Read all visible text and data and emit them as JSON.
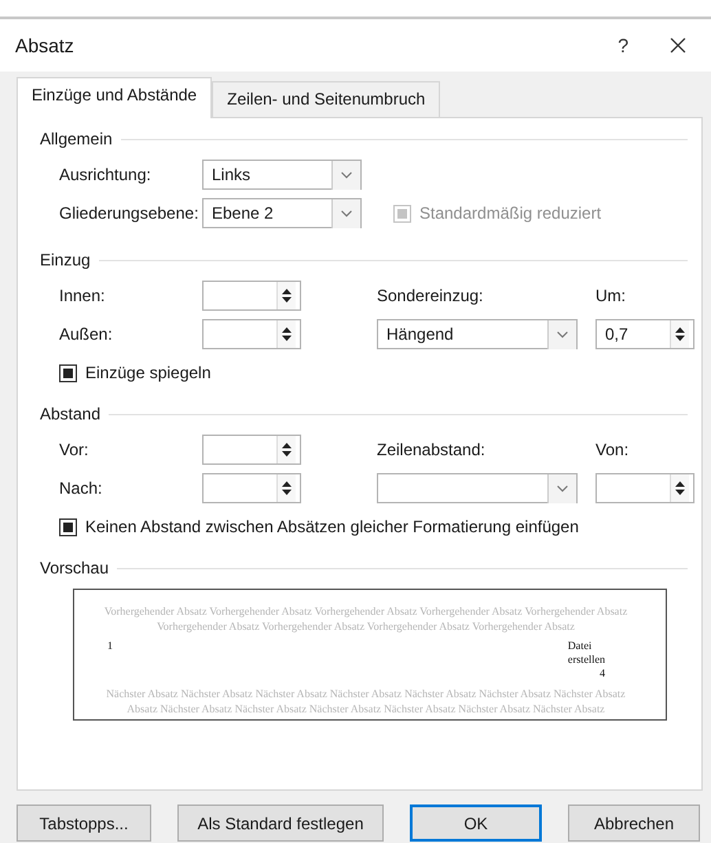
{
  "window": {
    "title": "Absatz",
    "help": "?"
  },
  "tabs": [
    {
      "label": "Einzüge und Abstände",
      "selected": true
    },
    {
      "label": "Zeilen- und Seitenumbruch",
      "selected": false
    }
  ],
  "general": {
    "title": "Allgemein",
    "alignment": {
      "label": "Ausrichtung:",
      "value": "Links"
    },
    "outline_level": {
      "label": "Gliederungsebene:",
      "value": "Ebene 2"
    },
    "collapsed": {
      "label": "Standardmäßig reduziert",
      "checked": true,
      "disabled": true
    }
  },
  "indent": {
    "title": "Einzug",
    "inside": {
      "label": "Innen:"
    },
    "outside": {
      "label": "Außen:"
    },
    "special": {
      "label": "Sondereinzug:",
      "value": "Hängend"
    },
    "by": {
      "label": "Um:",
      "value": "0,7"
    },
    "mirror": {
      "label": "Einzüge spiegeln",
      "checked": true,
      "disabled": false
    }
  },
  "spacing": {
    "title": "Abstand",
    "before": {
      "label": "Vor:"
    },
    "after": {
      "label": "Nach:"
    },
    "line_spacing": {
      "label": "Zeilenabstand:"
    },
    "at": {
      "label": "Von:"
    },
    "no_space": {
      "label": "Keinen Abstand zwischen Absätzen gleicher Formatierung einfügen",
      "checked": true,
      "disabled": false
    }
  },
  "preview": {
    "title": "Vorschau",
    "previous": "Vorhergehender Absatz Vorhergehender Absatz Vorhergehender Absatz Vorhergehender Absatz Vorhergehender Absatz Vorhergehender Absatz Vorhergehender Absatz Vorhergehender Absatz Vorhergehender Absatz",
    "number": "1",
    "text_lines": [
      "Datei",
      "erstellen"
    ],
    "page": "4",
    "next": "Nächster Absatz Nächster Absatz Nächster Absatz Nächster Absatz Nächster Absatz Nächster Absatz Nächster Absatz Absatz Nächster Absatz Nächster Absatz Nächster Absatz Nächster Absatz Nächster Absatz Nächster Absatz"
  },
  "buttons": [
    {
      "label": "Tabstopps...",
      "default": false
    },
    {
      "label": "Als Standard festlegen",
      "default": false
    },
    {
      "label": "OK",
      "default": true
    },
    {
      "label": "Abbrechen",
      "default": false
    }
  ]
}
